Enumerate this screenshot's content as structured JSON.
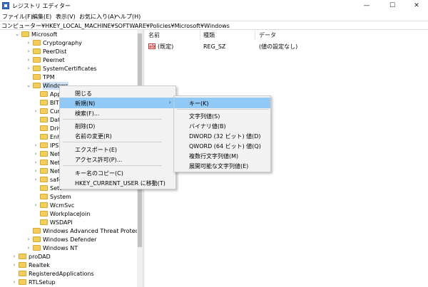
{
  "window": {
    "title": "レジストリ エディター",
    "minimize_glyph": "—",
    "maximize_glyph": "☐",
    "close_glyph": "✕"
  },
  "menubar": [
    "ファイル(F)",
    "編集(E)",
    "表示(V)",
    "お気に入り(A)",
    "ヘルプ(H)"
  ],
  "address": "コンピューター¥HKEY_LOCAL_MACHINE¥SOFTWARE¥Policies¥Microsoft¥Windows",
  "tree": [
    {
      "label": "Microsoft",
      "expander": "⌄"
    },
    {
      "label": "Cryptography",
      "expander": "›"
    },
    {
      "label": "PeerDist",
      "expander": "›"
    },
    {
      "label": "Peernet",
      "expander": "›"
    },
    {
      "label": "SystemCertificates",
      "expander": "›"
    },
    {
      "label": "TPM",
      "expander": ""
    },
    {
      "label": "Windows",
      "expander": "⌄",
      "selected": true
    },
    {
      "label": "App",
      "expander": ""
    },
    {
      "label": "BITS",
      "expander": ""
    },
    {
      "label": "Cur",
      "expander": "›"
    },
    {
      "label": "Dat",
      "expander": ""
    },
    {
      "label": "Driv",
      "expander": ""
    },
    {
      "label": "Enh",
      "expander": ""
    },
    {
      "label": "IPS",
      "expander": "›"
    },
    {
      "label": "Net",
      "expander": "›"
    },
    {
      "label": "Net",
      "expander": "›"
    },
    {
      "label": "Net",
      "expander": "›"
    },
    {
      "label": "safe",
      "expander": "›"
    },
    {
      "label": "Sett",
      "expander": ""
    },
    {
      "label": "System",
      "expander": ""
    },
    {
      "label": "WcmSvc",
      "expander": "›"
    },
    {
      "label": "WorkplaceJoin",
      "expander": ""
    },
    {
      "label": "WSDAPI",
      "expander": ""
    },
    {
      "label": "Windows Advanced Threat Protection",
      "expander": ""
    },
    {
      "label": "Windows Defender",
      "expander": "›"
    },
    {
      "label": "Windows NT",
      "expander": "›"
    },
    {
      "label": "proDAD",
      "expander": "›"
    },
    {
      "label": "Realtek",
      "expander": "›"
    },
    {
      "label": "RegisteredApplications",
      "expander": ""
    },
    {
      "label": "RTLSetup",
      "expander": "›"
    }
  ],
  "values_pane": {
    "headers": [
      "名前",
      "種類",
      "データ"
    ],
    "rows": [
      {
        "name": "(既定)",
        "type": "REG_SZ",
        "data": "(値の設定なし)"
      }
    ]
  },
  "context_menu": {
    "items": [
      {
        "label": "閉じる"
      },
      {
        "label": "新規(N)",
        "submenu": true,
        "hover": true
      },
      {
        "label": "検索(F)..."
      },
      {
        "label": "削除(D)"
      },
      {
        "label": "名前の変更(R)"
      },
      {
        "label": "エクスポート(E)"
      },
      {
        "label": "アクセス許可(P)..."
      },
      {
        "label": "キー名のコピー(C)"
      },
      {
        "label": "HKEY_CURRENT_USER に移動(T)"
      }
    ],
    "submenu_arrow": "›"
  },
  "submenu": {
    "items": [
      {
        "label": "キー(K)",
        "hover": true
      },
      {
        "label": "文字列値(S)"
      },
      {
        "label": "バイナリ値(B)"
      },
      {
        "label": "DWORD (32 ビット) 値(D)"
      },
      {
        "label": "QWORD (64 ビット) 値(Q)"
      },
      {
        "label": "複数行文字列値(M)"
      },
      {
        "label": "展開可能な文字列値(E)"
      }
    ]
  },
  "icons": {
    "string_value": "ab"
  },
  "colors": {
    "hover": "#91c9f7",
    "folder": "#f3cd5a",
    "selected": "#cde0f5"
  }
}
